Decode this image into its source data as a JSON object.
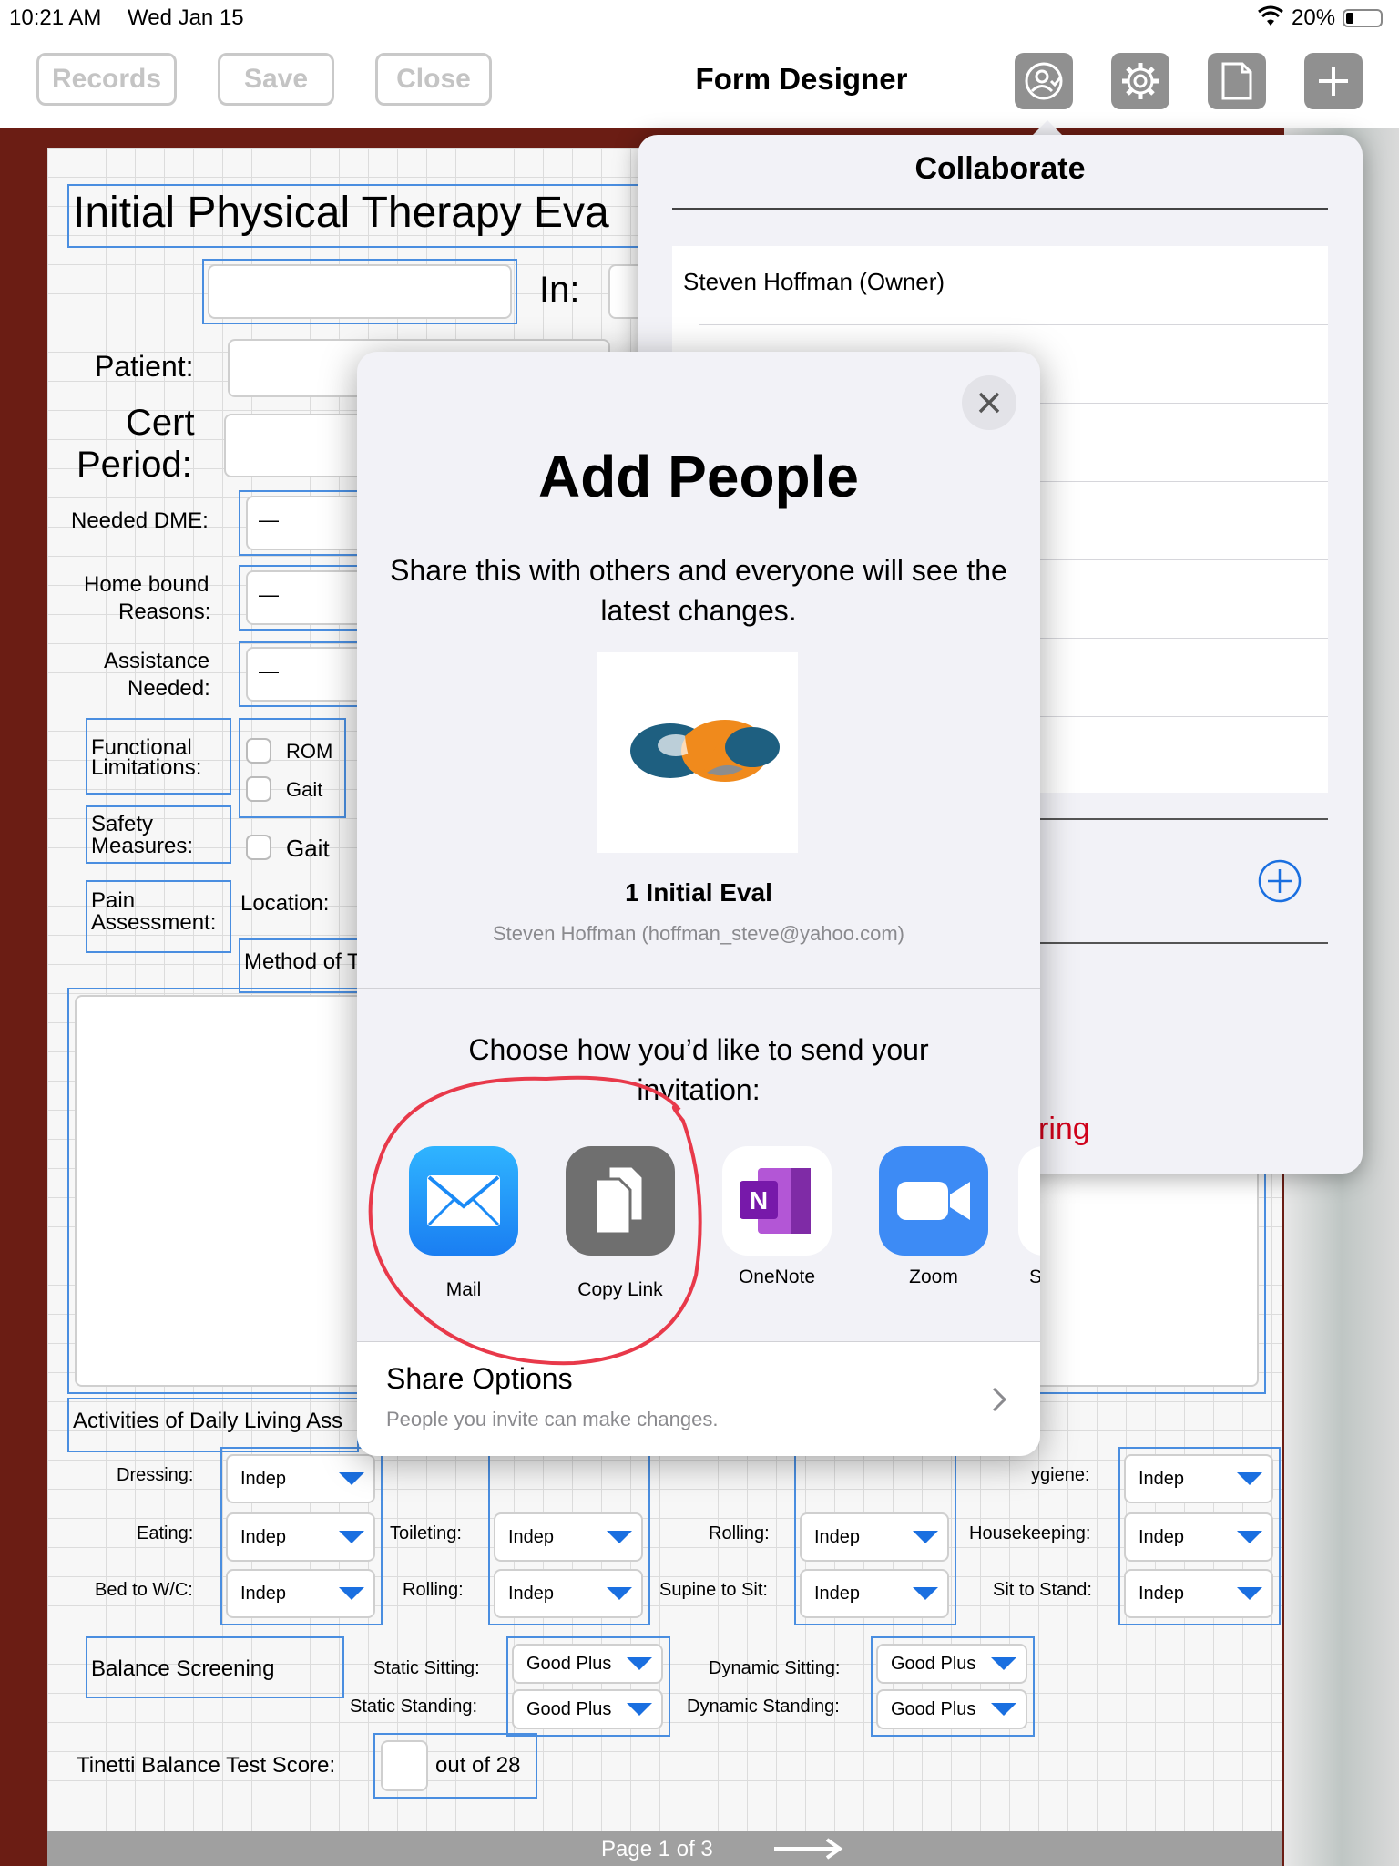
{
  "status": {
    "time": "10:21 AM",
    "date": "Wed Jan 15",
    "battery": "20%"
  },
  "nav": {
    "records": "Records",
    "save": "Save",
    "close": "Close",
    "title": "Form Designer"
  },
  "form": {
    "title": "Initial Physical Therapy Eva",
    "in_label": "In:",
    "patient_label": "Patient:",
    "cert_label_1": "Cert",
    "cert_label_2": "Period:",
    "needed_dme": "Needed DME:",
    "home_bound_1": "Home bound",
    "home_bound_2": "Reasons:",
    "assistance_1": "Assistance",
    "assistance_2": "Needed:",
    "dash": "—",
    "functional_1": "Functional",
    "functional_2": "Limitations:",
    "safety_1": "Safety",
    "safety_2": "Measures:",
    "pain_1": "Pain",
    "pain_2": "Assessment:",
    "rom": "ROM",
    "gait": "Gait",
    "location": "Location:",
    "method": "Method of T",
    "adl": "Activities of Daily Living Ass",
    "hygiene": "ygiene:",
    "dressing": "Dressing:",
    "eating": "Eating:",
    "toileting": "Toileting:",
    "rolling": "Rolling:",
    "housekeeping": "Housekeeping:",
    "bed_to_wc": "Bed to W/C:",
    "supine_to_sit": "Supine to Sit:",
    "sit_to_stand": "Sit to Stand:",
    "indep": "Indep",
    "balance": "Balance Screening",
    "static_sitting": "Static Sitting:",
    "static_standing": "Static Standing:",
    "dynamic_sitting": "Dynamic Sitting:",
    "dynamic_standing": "Dynamic Standing:",
    "good_plus": "Good Plus",
    "tinetti": "Tinetti Balance Test Score:",
    "out_of": "out of 28",
    "page": "Page 1 of 3"
  },
  "collaborate": {
    "title": "Collaborate",
    "owner": "Steven Hoffman (Owner)",
    "stop_sharing_fragment": "ring"
  },
  "add_people": {
    "title": "Add People",
    "description": "Share this with others and everyone will see the latest changes.",
    "doc_name": "1 Initial Eval",
    "owner_email": "Steven Hoffman (hoffman_steve@yahoo.com)",
    "choose": "Choose how you’d like to send your invitation:",
    "apps": [
      {
        "label": "Mail",
        "icon": "mail-icon"
      },
      {
        "label": "Copy Link",
        "icon": "copy-link-icon"
      },
      {
        "label": "OneNote",
        "icon": "onenote-icon"
      },
      {
        "label": "Zoom",
        "icon": "zoom-icon"
      },
      {
        "label": "S",
        "icon": "skype-icon"
      }
    ],
    "share_options": "Share Options",
    "share_options_sub": "People you invite can make changes."
  },
  "colors": {
    "accent": "#1a6fe0",
    "destructive": "#d0021b",
    "annotation": "#e8394a",
    "frame": "#6b1d14"
  }
}
